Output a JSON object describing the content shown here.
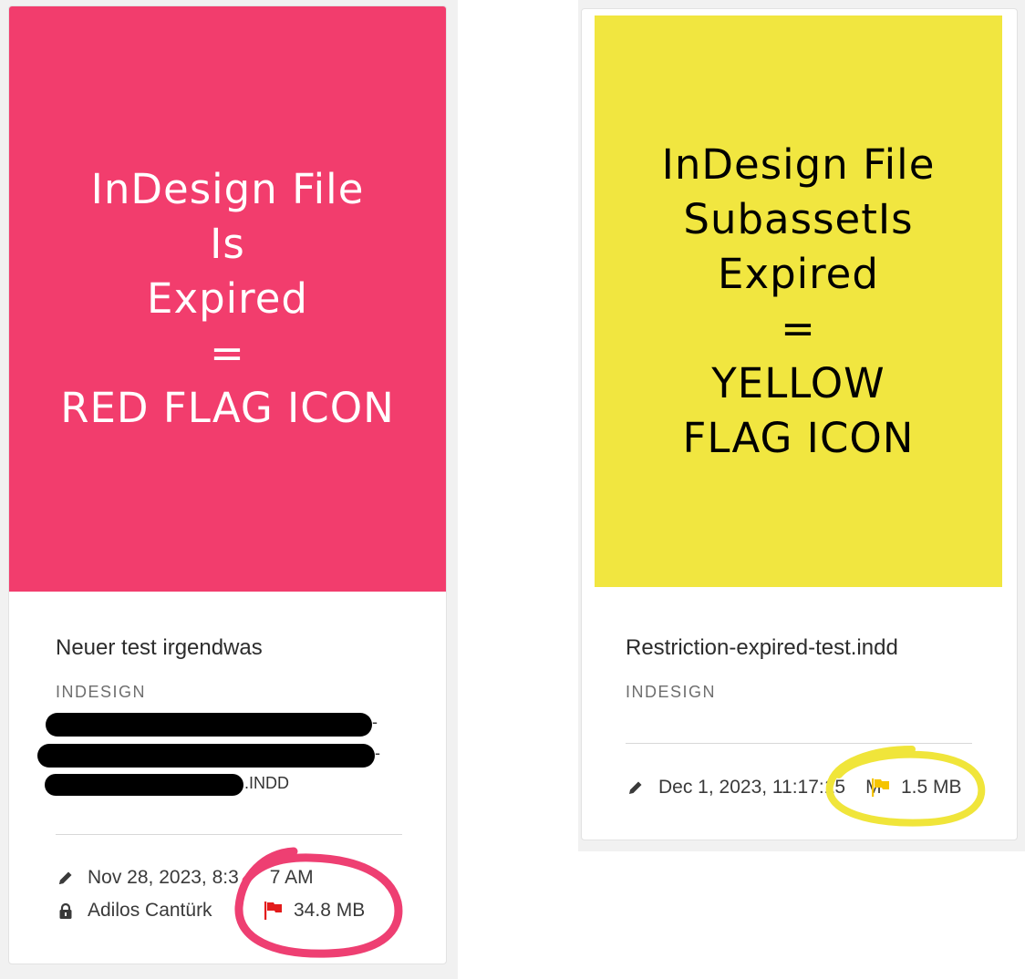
{
  "colors": {
    "red_thumb": "#f23d6d",
    "yellow_thumb": "#f1e640",
    "red_flag": "#e31b1b",
    "yellow_flag": "#f5c400",
    "red_marker": "#ee3f72",
    "yellow_marker": "#f0e53a"
  },
  "left_card": {
    "thumbnail_lines": [
      "InDesign File",
      "Is",
      "Expired",
      "=",
      "RED FLAG ICON"
    ],
    "title": "Neuer test irgendwas",
    "type": "INDESIGN",
    "path_tail_1": "-",
    "path_tail_2": "-",
    "path_tail_3": ".INDD",
    "modified": "Nov 28, 2023, 8:3",
    "modified_tail": "7 AM",
    "owner": "Adilos Cantürk",
    "size": "34.8 MB",
    "flag_icon": "red-flag-icon"
  },
  "right_card": {
    "thumbnail_lines": [
      "InDesign File",
      "SubassetIs",
      "Expired",
      "=",
      "YELLOW",
      "FLAG ICON"
    ],
    "title": "Restriction-expired-test.indd",
    "type": "INDESIGN",
    "modified": "Dec 1, 2023, 11:17:15",
    "modified_tail": "M",
    "size": "1.5 MB",
    "flag_icon": "yellow-flag-icon"
  }
}
